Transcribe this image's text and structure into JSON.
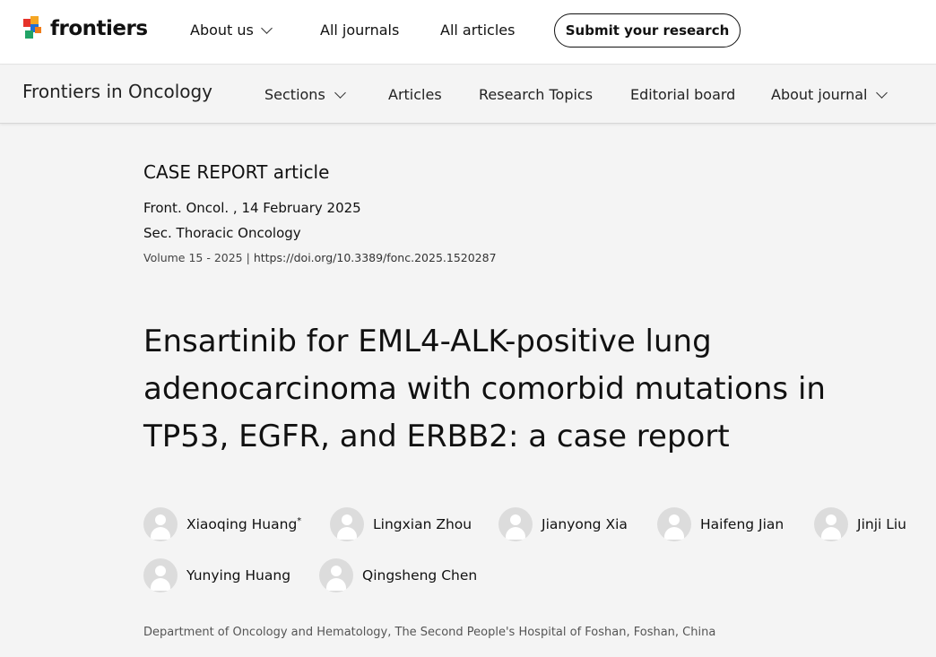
{
  "top_nav": {
    "logo_text": "frontiers",
    "links": [
      "About us",
      "All journals",
      "All articles"
    ],
    "submit_label": "Submit your research"
  },
  "journal_nav": {
    "title": "Frontiers in Oncology",
    "links": [
      "Sections",
      "Articles",
      "Research Topics",
      "Editorial board",
      "About journal"
    ]
  },
  "article": {
    "type": "CASE REPORT article",
    "citation": "Front. Oncol. , 14 February 2025",
    "section": "Sec. Thoracic Oncology",
    "volume": "Volume 15 - 2025 |",
    "doi": "https://doi.org/10.3389/fonc.2025.1520287",
    "title_lines": [
      "Ensartinib for EML4-ALK-positive lung",
      "adenocarcinoma with comorbid mutations in",
      "TP53, EGFR, and ERBB2: a case report"
    ],
    "authors": [
      {
        "name": "Xiaoqing Huang",
        "mark": "*"
      },
      {
        "name": "Lingxian Zhou",
        "mark": ""
      },
      {
        "name": "Jianyong Xia",
        "mark": ""
      },
      {
        "name": "Haifeng Jian",
        "mark": ""
      },
      {
        "name": "Jinji Liu",
        "mark": ""
      },
      {
        "name": "Yunying Huang",
        "mark": ""
      },
      {
        "name": "Qingsheng Chen",
        "mark": ""
      }
    ],
    "affiliation": "Department of Oncology and Hematology, The Second People's Hospital of Foshan, Foshan, China"
  },
  "colors": {
    "page_bg": "#f4f4f4",
    "header_bg": "#ffffff",
    "avatar_bg": "#dcdcdc",
    "logo_colors": [
      "#e6332a",
      "#f5a623",
      "#1e6fd9",
      "#21a366"
    ]
  }
}
